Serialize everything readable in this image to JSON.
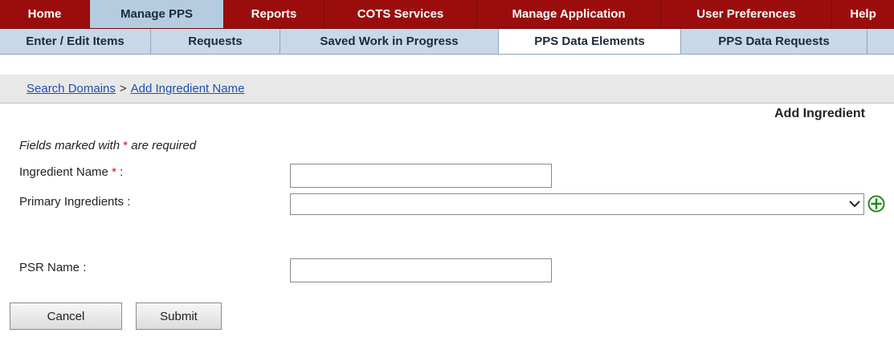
{
  "topnav": {
    "items": [
      {
        "label": "Home"
      },
      {
        "label": "Manage PPS"
      },
      {
        "label": "Reports"
      },
      {
        "label": "COTS Services"
      },
      {
        "label": "Manage Application"
      },
      {
        "label": "User Preferences"
      },
      {
        "label": "Help"
      }
    ],
    "active": "Manage PPS"
  },
  "subnav": {
    "items": [
      {
        "label": "Enter / Edit Items"
      },
      {
        "label": "Requests"
      },
      {
        "label": "Saved Work in Progress"
      },
      {
        "label": "PPS Data Elements"
      },
      {
        "label": "PPS Data Requests"
      }
    ],
    "active": "PPS Data Elements"
  },
  "breadcrumb": {
    "items": [
      "Search Domains",
      "Add Ingredient Name"
    ],
    "separator": ">"
  },
  "page": {
    "title": "Add Ingredient",
    "required_note_prefix": "Fields marked with",
    "required_note_star": "*",
    "required_note_suffix": "are required"
  },
  "form": {
    "ingredient_name": {
      "label": "Ingredient Name",
      "star": "*",
      "colon": ":",
      "value": ""
    },
    "primary_ingredients": {
      "label": "Primary Ingredients :",
      "value": "",
      "add_icon": "plus-circle-icon"
    },
    "psr_name": {
      "label": "PSR Name :",
      "value": ""
    }
  },
  "buttons": {
    "cancel": "Cancel",
    "submit": "Submit"
  },
  "colors": {
    "topnav_bg": "#9b0d0d",
    "active_top_tab": "#b5cce0",
    "subnav_bg": "#c8d8e8",
    "link": "#1f4fb0",
    "required_star": "#d01010",
    "add_icon": "#1a8a1a"
  }
}
